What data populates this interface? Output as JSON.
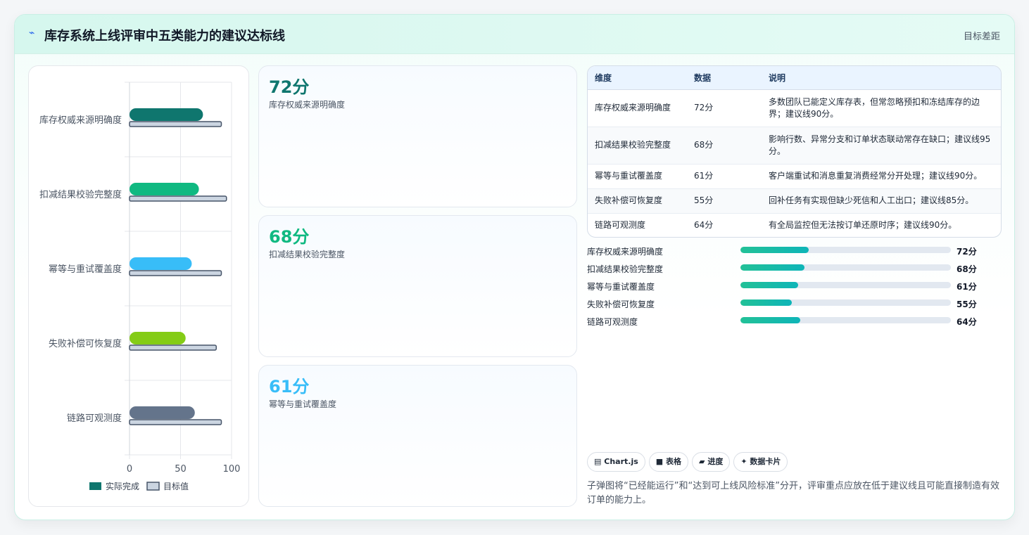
{
  "header": {
    "icon": "lightning-icon",
    "title": "库存系统上线评审中五类能力的建议达标线",
    "link": "目标差距"
  },
  "colors": {
    "series": [
      "#0f766e",
      "#10b981",
      "#38bdf8",
      "#84cc16",
      "#64748b"
    ],
    "target": "#cbd5e1",
    "target_border": "#475569"
  },
  "chart_data": {
    "type": "bar",
    "orientation": "horizontal",
    "categories": [
      "库存权威来源明确度",
      "扣减结果校验完整度",
      "幂等与重试覆盖度",
      "失败补偿可恢复度",
      "链路可观测度"
    ],
    "series": [
      {
        "name": "实际完成",
        "values": [
          72,
          68,
          61,
          55,
          64
        ]
      },
      {
        "name": "目标值",
        "values": [
          90,
          95,
          90,
          85,
          90
        ]
      }
    ],
    "xlim": [
      0,
      100
    ],
    "xticks": [
      "0",
      "50",
      "100"
    ],
    "legend": "bottom",
    "grid": true
  },
  "score_cards": [
    {
      "value": "72分",
      "label": "库存权威来源明确度",
      "color": "#0f766e"
    },
    {
      "value": "68分",
      "label": "扣减结果校验完整度",
      "color": "#10b981"
    },
    {
      "value": "61分",
      "label": "幂等与重试覆盖度",
      "color": "#38bdf8"
    }
  ],
  "table": {
    "headers": [
      "维度",
      "数据",
      "说明"
    ],
    "rows": [
      [
        "库存权威来源明确度",
        "72分",
        "多数团队已能定义库存表，但常忽略预扣和冻结库存的边界；建议线90分。"
      ],
      [
        "扣减结果校验完整度",
        "68分",
        "影响行数、异常分支和订单状态联动常存在缺口；建议线95分。"
      ],
      [
        "幂等与重试覆盖度",
        "61分",
        "客户端重试和消息重复消费经常分开处理；建议线90分。"
      ],
      [
        "失败补偿可恢复度",
        "55分",
        "回补任务有实现但缺少死信和人工出口；建议线85分。"
      ],
      [
        "链路可观测度",
        "64分",
        "有全局监控但无法按订单还原时序；建议线90分。"
      ]
    ]
  },
  "progress": [
    {
      "label": "库存权威来源明确度",
      "value": "72分",
      "fraction": 0.325
    },
    {
      "label": "扣减结果校验完整度",
      "value": "68分",
      "fraction": 0.305
    },
    {
      "label": "幂等与重试覆盖度",
      "value": "61分",
      "fraction": 0.275
    },
    {
      "label": "失败补偿可恢复度",
      "value": "55分",
      "fraction": 0.245
    },
    {
      "label": "链路可观测度",
      "value": "64分",
      "fraction": 0.285
    }
  ],
  "chips": [
    {
      "icon": "chart-icon",
      "glyph": "▤",
      "label": "Chart.js"
    },
    {
      "icon": "table-icon",
      "glyph": "■",
      "label": "表格"
    },
    {
      "icon": "progress-icon",
      "glyph": "▰",
      "label": "进度"
    },
    {
      "icon": "sparkle-icon",
      "glyph": "✦",
      "label": "数据卡片"
    }
  ],
  "footnote": "子弹图将“已经能运行”和“达到可上线风险标准”分开，评审重点应放在低于建议线且可能直接制造有效订单的能力上。"
}
